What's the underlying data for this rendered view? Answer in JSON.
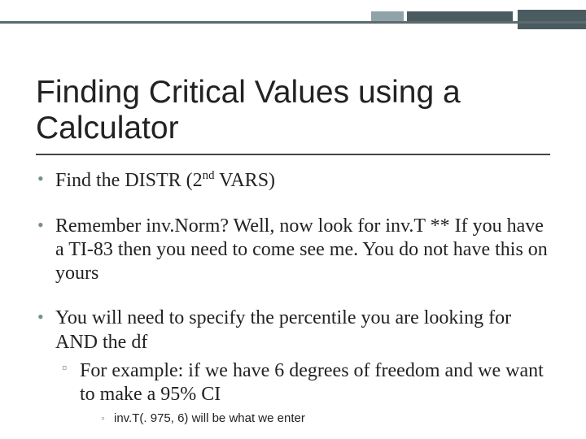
{
  "title": "Finding Critical Values using a Calculator",
  "b1": {
    "pre": "Find the DISTR (2",
    "sup": "nd",
    "post": " VARS)"
  },
  "b2": "Remember inv.Norm? Well, now look for inv.T ** If you have a TI-83 then you need to come see me. You do not have this on yours",
  "b3": {
    "text": "You will need to specify the percentile you are looking for AND the df",
    "sub": "For example: if we have 6 degrees of freedom and we want to make a 95% CI",
    "sub2": "inv.T(. 975, 6) will be what we enter"
  }
}
